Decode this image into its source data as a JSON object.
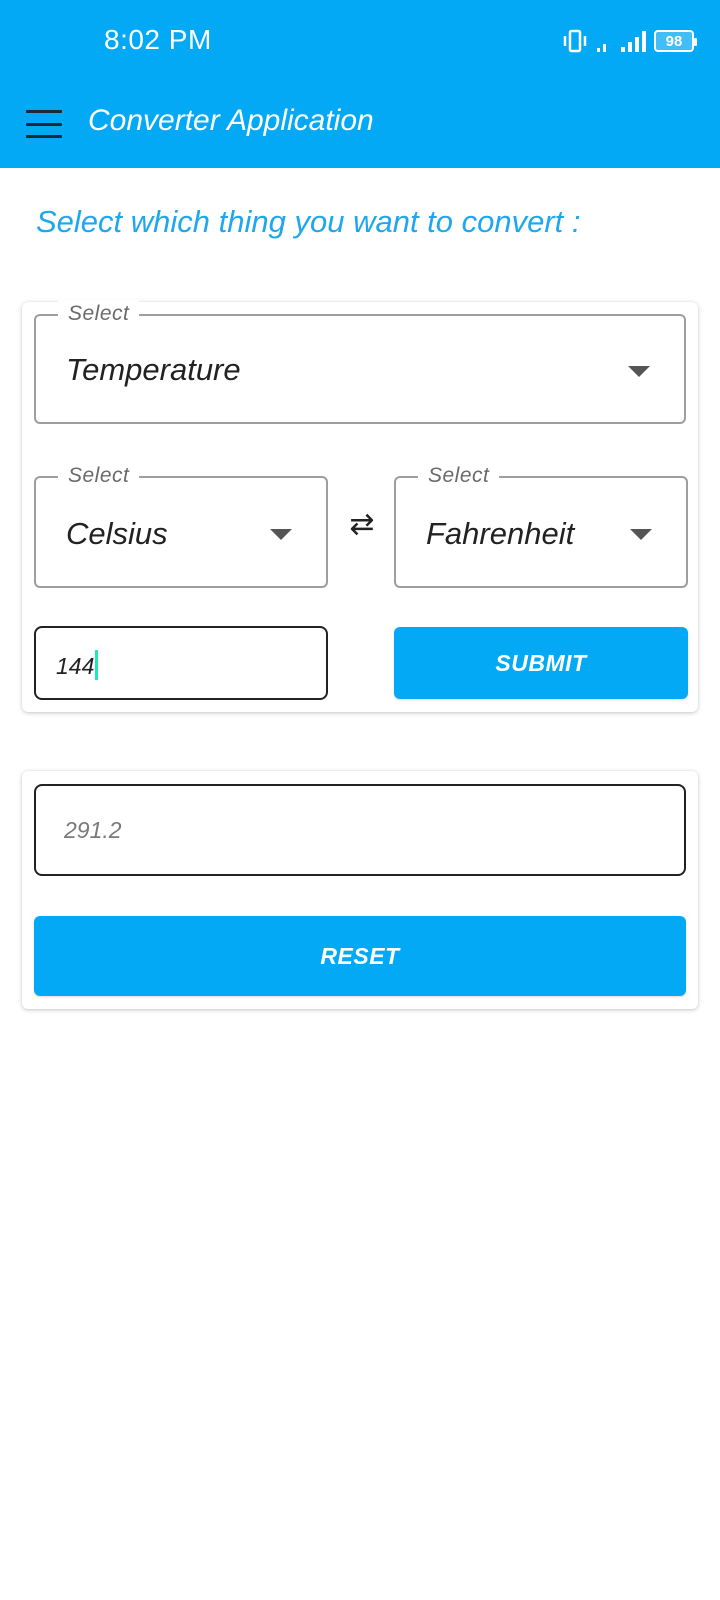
{
  "status_bar": {
    "time": "8:02 PM",
    "battery_level": "98",
    "icons": [
      "vibrate-icon",
      "wifi-signal-icon",
      "cell-signal-icon",
      "battery-icon"
    ]
  },
  "app_bar": {
    "title": "Converter Application",
    "menu_icon": "hamburger-menu-icon"
  },
  "heading": "Select which thing you want to convert :",
  "converter": {
    "type_select": {
      "label": "Select",
      "value": "Temperature"
    },
    "from_select": {
      "label": "Select",
      "value": "Celsius"
    },
    "swap_icon": "swap-arrows-icon",
    "to_select": {
      "label": "Select",
      "value": "Fahrenheit"
    },
    "input_value": "144",
    "submit_label": "SUBMIT"
  },
  "result": {
    "output_value": "291.2",
    "reset_label": "RESET"
  },
  "colors": {
    "primary": "#03a9f4",
    "heading_text": "#1ea7ef",
    "cursor": "#1de9b6"
  }
}
